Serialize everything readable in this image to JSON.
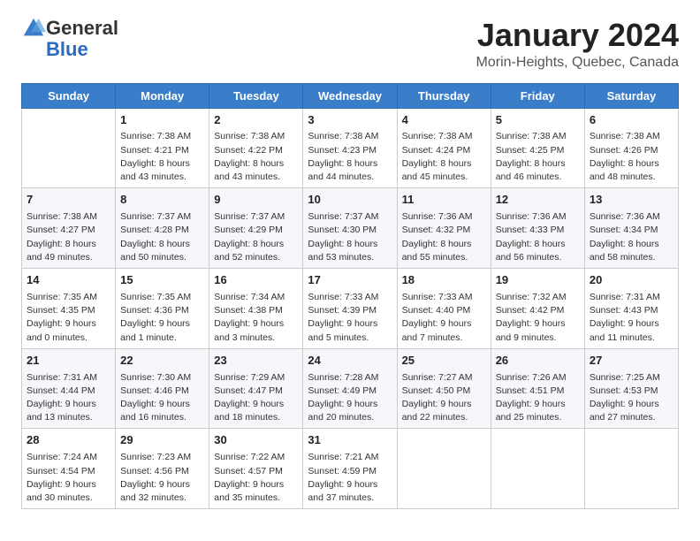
{
  "logo": {
    "text_general": "General",
    "text_blue": "Blue"
  },
  "header": {
    "title": "January 2024",
    "subtitle": "Morin-Heights, Quebec, Canada"
  },
  "weekdays": [
    "Sunday",
    "Monday",
    "Tuesday",
    "Wednesday",
    "Thursday",
    "Friday",
    "Saturday"
  ],
  "weeks": [
    [
      {
        "day": "",
        "sunrise": "",
        "sunset": "",
        "daylight": ""
      },
      {
        "day": "1",
        "sunrise": "Sunrise: 7:38 AM",
        "sunset": "Sunset: 4:21 PM",
        "daylight": "Daylight: 8 hours and 43 minutes."
      },
      {
        "day": "2",
        "sunrise": "Sunrise: 7:38 AM",
        "sunset": "Sunset: 4:22 PM",
        "daylight": "Daylight: 8 hours and 43 minutes."
      },
      {
        "day": "3",
        "sunrise": "Sunrise: 7:38 AM",
        "sunset": "Sunset: 4:23 PM",
        "daylight": "Daylight: 8 hours and 44 minutes."
      },
      {
        "day": "4",
        "sunrise": "Sunrise: 7:38 AM",
        "sunset": "Sunset: 4:24 PM",
        "daylight": "Daylight: 8 hours and 45 minutes."
      },
      {
        "day": "5",
        "sunrise": "Sunrise: 7:38 AM",
        "sunset": "Sunset: 4:25 PM",
        "daylight": "Daylight: 8 hours and 46 minutes."
      },
      {
        "day": "6",
        "sunrise": "Sunrise: 7:38 AM",
        "sunset": "Sunset: 4:26 PM",
        "daylight": "Daylight: 8 hours and 48 minutes."
      }
    ],
    [
      {
        "day": "7",
        "sunrise": "Sunrise: 7:38 AM",
        "sunset": "Sunset: 4:27 PM",
        "daylight": "Daylight: 8 hours and 49 minutes."
      },
      {
        "day": "8",
        "sunrise": "Sunrise: 7:37 AM",
        "sunset": "Sunset: 4:28 PM",
        "daylight": "Daylight: 8 hours and 50 minutes."
      },
      {
        "day": "9",
        "sunrise": "Sunrise: 7:37 AM",
        "sunset": "Sunset: 4:29 PM",
        "daylight": "Daylight: 8 hours and 52 minutes."
      },
      {
        "day": "10",
        "sunrise": "Sunrise: 7:37 AM",
        "sunset": "Sunset: 4:30 PM",
        "daylight": "Daylight: 8 hours and 53 minutes."
      },
      {
        "day": "11",
        "sunrise": "Sunrise: 7:36 AM",
        "sunset": "Sunset: 4:32 PM",
        "daylight": "Daylight: 8 hours and 55 minutes."
      },
      {
        "day": "12",
        "sunrise": "Sunrise: 7:36 AM",
        "sunset": "Sunset: 4:33 PM",
        "daylight": "Daylight: 8 hours and 56 minutes."
      },
      {
        "day": "13",
        "sunrise": "Sunrise: 7:36 AM",
        "sunset": "Sunset: 4:34 PM",
        "daylight": "Daylight: 8 hours and 58 minutes."
      }
    ],
    [
      {
        "day": "14",
        "sunrise": "Sunrise: 7:35 AM",
        "sunset": "Sunset: 4:35 PM",
        "daylight": "Daylight: 9 hours and 0 minutes."
      },
      {
        "day": "15",
        "sunrise": "Sunrise: 7:35 AM",
        "sunset": "Sunset: 4:36 PM",
        "daylight": "Daylight: 9 hours and 1 minute."
      },
      {
        "day": "16",
        "sunrise": "Sunrise: 7:34 AM",
        "sunset": "Sunset: 4:38 PM",
        "daylight": "Daylight: 9 hours and 3 minutes."
      },
      {
        "day": "17",
        "sunrise": "Sunrise: 7:33 AM",
        "sunset": "Sunset: 4:39 PM",
        "daylight": "Daylight: 9 hours and 5 minutes."
      },
      {
        "day": "18",
        "sunrise": "Sunrise: 7:33 AM",
        "sunset": "Sunset: 4:40 PM",
        "daylight": "Daylight: 9 hours and 7 minutes."
      },
      {
        "day": "19",
        "sunrise": "Sunrise: 7:32 AM",
        "sunset": "Sunset: 4:42 PM",
        "daylight": "Daylight: 9 hours and 9 minutes."
      },
      {
        "day": "20",
        "sunrise": "Sunrise: 7:31 AM",
        "sunset": "Sunset: 4:43 PM",
        "daylight": "Daylight: 9 hours and 11 minutes."
      }
    ],
    [
      {
        "day": "21",
        "sunrise": "Sunrise: 7:31 AM",
        "sunset": "Sunset: 4:44 PM",
        "daylight": "Daylight: 9 hours and 13 minutes."
      },
      {
        "day": "22",
        "sunrise": "Sunrise: 7:30 AM",
        "sunset": "Sunset: 4:46 PM",
        "daylight": "Daylight: 9 hours and 16 minutes."
      },
      {
        "day": "23",
        "sunrise": "Sunrise: 7:29 AM",
        "sunset": "Sunset: 4:47 PM",
        "daylight": "Daylight: 9 hours and 18 minutes."
      },
      {
        "day": "24",
        "sunrise": "Sunrise: 7:28 AM",
        "sunset": "Sunset: 4:49 PM",
        "daylight": "Daylight: 9 hours and 20 minutes."
      },
      {
        "day": "25",
        "sunrise": "Sunrise: 7:27 AM",
        "sunset": "Sunset: 4:50 PM",
        "daylight": "Daylight: 9 hours and 22 minutes."
      },
      {
        "day": "26",
        "sunrise": "Sunrise: 7:26 AM",
        "sunset": "Sunset: 4:51 PM",
        "daylight": "Daylight: 9 hours and 25 minutes."
      },
      {
        "day": "27",
        "sunrise": "Sunrise: 7:25 AM",
        "sunset": "Sunset: 4:53 PM",
        "daylight": "Daylight: 9 hours and 27 minutes."
      }
    ],
    [
      {
        "day": "28",
        "sunrise": "Sunrise: 7:24 AM",
        "sunset": "Sunset: 4:54 PM",
        "daylight": "Daylight: 9 hours and 30 minutes."
      },
      {
        "day": "29",
        "sunrise": "Sunrise: 7:23 AM",
        "sunset": "Sunset: 4:56 PM",
        "daylight": "Daylight: 9 hours and 32 minutes."
      },
      {
        "day": "30",
        "sunrise": "Sunrise: 7:22 AM",
        "sunset": "Sunset: 4:57 PM",
        "daylight": "Daylight: 9 hours and 35 minutes."
      },
      {
        "day": "31",
        "sunrise": "Sunrise: 7:21 AM",
        "sunset": "Sunset: 4:59 PM",
        "daylight": "Daylight: 9 hours and 37 minutes."
      },
      {
        "day": "",
        "sunrise": "",
        "sunset": "",
        "daylight": ""
      },
      {
        "day": "",
        "sunrise": "",
        "sunset": "",
        "daylight": ""
      },
      {
        "day": "",
        "sunrise": "",
        "sunset": "",
        "daylight": ""
      }
    ]
  ]
}
